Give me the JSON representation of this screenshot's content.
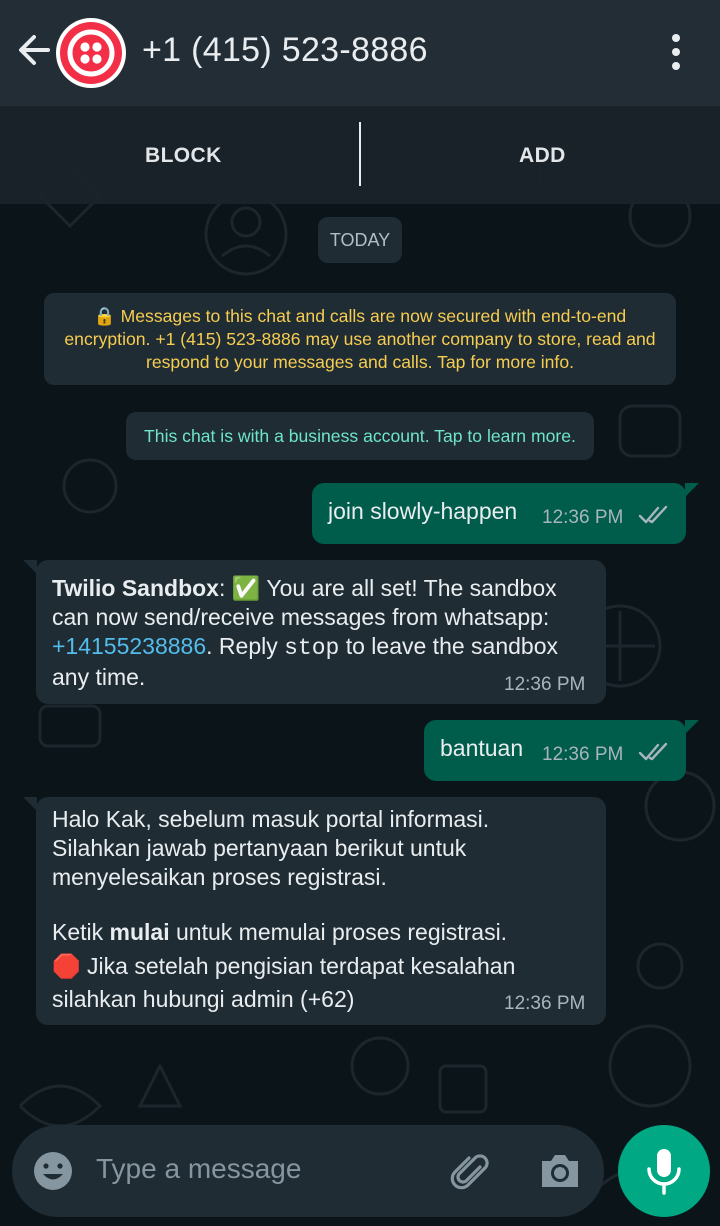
{
  "header": {
    "back_icon": "arrow-left-icon",
    "avatar_icon": "twilio-logo",
    "title": "+1 (415) 523-8886",
    "menu_icon": "more-vertical-icon"
  },
  "actions": {
    "block_label": "BLOCK",
    "add_label": "ADD"
  },
  "chat": {
    "date_label": "TODAY",
    "encryption_notice": "🔒 Messages to this chat and calls are now secured with end-to-end encryption. +1 (415) 523-8886 may use another company to store, read and respond to your messages and calls. Tap for more info.",
    "business_notice": "This chat is with a business account. Tap to learn more.",
    "messages": [
      {
        "direction": "outgoing",
        "text": "join slowly-happen",
        "time": "12:36 PM",
        "status_icon": "double-check-icon"
      },
      {
        "direction": "incoming",
        "sender": "Twilio Sandbox",
        "sep": ": ",
        "emoji": "✅",
        "text_a": " You are all set! The sandbox can now send/receive messages from whatsapp: ",
        "link": "+14155238886",
        "text_b": ". Reply ",
        "code": "stop",
        "text_c": " to leave the sandbox any time.",
        "time": "12:36 PM"
      },
      {
        "direction": "outgoing",
        "text": "bantuan",
        "time": "12:36 PM",
        "status_icon": "double-check-icon"
      },
      {
        "direction": "incoming",
        "line1": "Halo Kak, sebelum masuk portal informasi.",
        "line2": "Silahkan jawab pertanyaan berikut untuk",
        "line3": "menyelesaikan proses registrasi.",
        "line4_a": "Ketik ",
        "line4_bold": "mulai",
        "line4_b": " untuk memulai proses registrasi.",
        "emoji": "🛑",
        "line5": " Jika setelah pengisian terdapat kesalahan",
        "line6": "silahkan hubungi admin (+62)",
        "time": "12:36 PM"
      }
    ]
  },
  "composer": {
    "placeholder": "Type a message",
    "emoji_icon": "emoji-icon",
    "attach_icon": "paperclip-icon",
    "camera_icon": "camera-icon",
    "mic_icon": "microphone-icon"
  },
  "colors": {
    "header_bg": "#232d36",
    "outgoing_bubble": "#005c4b",
    "incoming_bubble": "#1f2c34",
    "accent": "#00a884",
    "encryption_text": "#f7cd51",
    "business_text": "#6ee5c9",
    "link": "#53bdeb"
  }
}
